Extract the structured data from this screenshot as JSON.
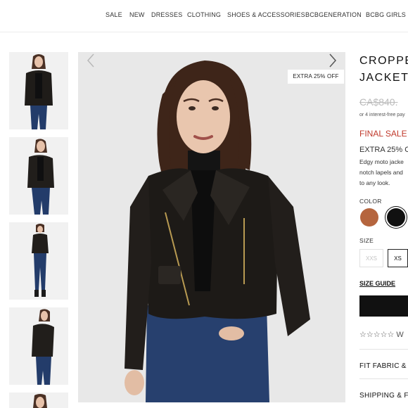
{
  "nav": {
    "items": [
      "SALE",
      "NEW",
      "DRESSES",
      "CLOTHING",
      "SHOES & ACCESSORIES",
      "BCBGENERATION",
      "BCBG GIRLS"
    ]
  },
  "gallery": {
    "badge": "EXTRA 25% OFF",
    "prev_icon": "chevron-left-icon",
    "next_icon": "chevron-right-icon"
  },
  "product": {
    "title_line1": "CROPPE",
    "title_line2": "JACKET",
    "price_original": "CA$840.",
    "installments": "or 4 interest-free pay",
    "final_sale": "FINAL SALE",
    "extra_offer": "EXTRA 25% O",
    "description_lines": [
      "Edgy moto jacke",
      "notch lapels and",
      "to any look."
    ],
    "color_label": "COLOR",
    "colors": [
      {
        "name": "cognac",
        "hex": "#b5653e"
      },
      {
        "name": "black",
        "hex": "#111111"
      }
    ],
    "size_label": "SIZE",
    "sizes": [
      {
        "label": "XXS",
        "available": false
      },
      {
        "label": "XS",
        "available": true
      }
    ],
    "size_guide": "SIZE GUIDE",
    "reviews_text": "W",
    "accordion": [
      "FIT FABRIC &",
      "SHIPPING & F"
    ]
  },
  "colors": {
    "sale_red": "#c0392b",
    "text_dark": "#111111",
    "muted": "#bbbbbb",
    "image_bg": "#e9e9e9"
  }
}
